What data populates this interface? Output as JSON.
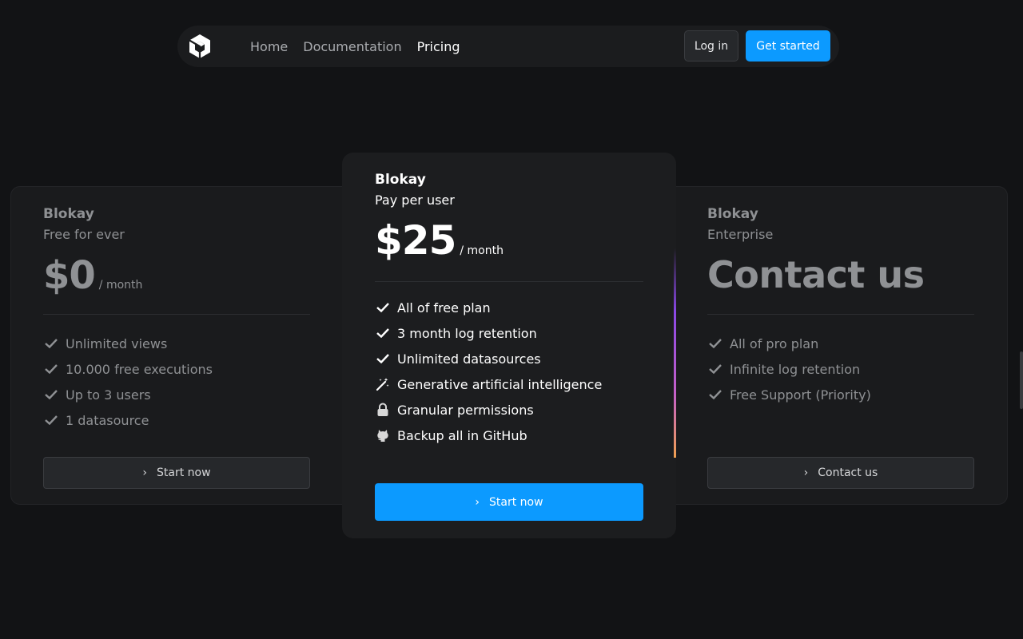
{
  "nav": {
    "links": [
      {
        "label": "Home",
        "active": false
      },
      {
        "label": "Documentation",
        "active": false
      },
      {
        "label": "Pricing",
        "active": true
      }
    ],
    "login_label": "Log in",
    "get_started_label": "Get started"
  },
  "plans": {
    "free": {
      "brand": "Blokay",
      "subtitle": "Free for ever",
      "price": "$0",
      "per": "/ month",
      "features": [
        {
          "icon": "check-icon",
          "label": "Unlimited views"
        },
        {
          "icon": "check-icon",
          "label": "10.000 free executions"
        },
        {
          "icon": "check-icon",
          "label": "Up to 3 users"
        },
        {
          "icon": "check-icon",
          "label": "1 datasource"
        }
      ],
      "cta": "Start now"
    },
    "pro": {
      "brand": "Blokay",
      "subtitle": "Pay per user",
      "price": "$25",
      "per": "/ month",
      "features": [
        {
          "icon": "check-icon",
          "label": "All of free plan"
        },
        {
          "icon": "check-icon",
          "label": "3 month log retention"
        },
        {
          "icon": "check-icon",
          "label": "Unlimited datasources"
        },
        {
          "icon": "magic-wand-icon",
          "label": "Generative artificial intelligence"
        },
        {
          "icon": "lock-icon",
          "label": "Granular permissions"
        },
        {
          "icon": "github-icon",
          "label": "Backup all in GitHub"
        }
      ],
      "cta": "Start now"
    },
    "enterprise": {
      "brand": "Blokay",
      "subtitle": "Enterprise",
      "price": "Contact us",
      "features": [
        {
          "icon": "check-icon",
          "label": "All of pro plan"
        },
        {
          "icon": "check-icon",
          "label": "Infinite log retention"
        },
        {
          "icon": "check-icon",
          "label": "Free Support (Priority)"
        }
      ],
      "cta": "Contact us"
    }
  },
  "colors": {
    "background": "#121315",
    "accent": "#0c9aff",
    "muted_text": "#8f9194"
  }
}
